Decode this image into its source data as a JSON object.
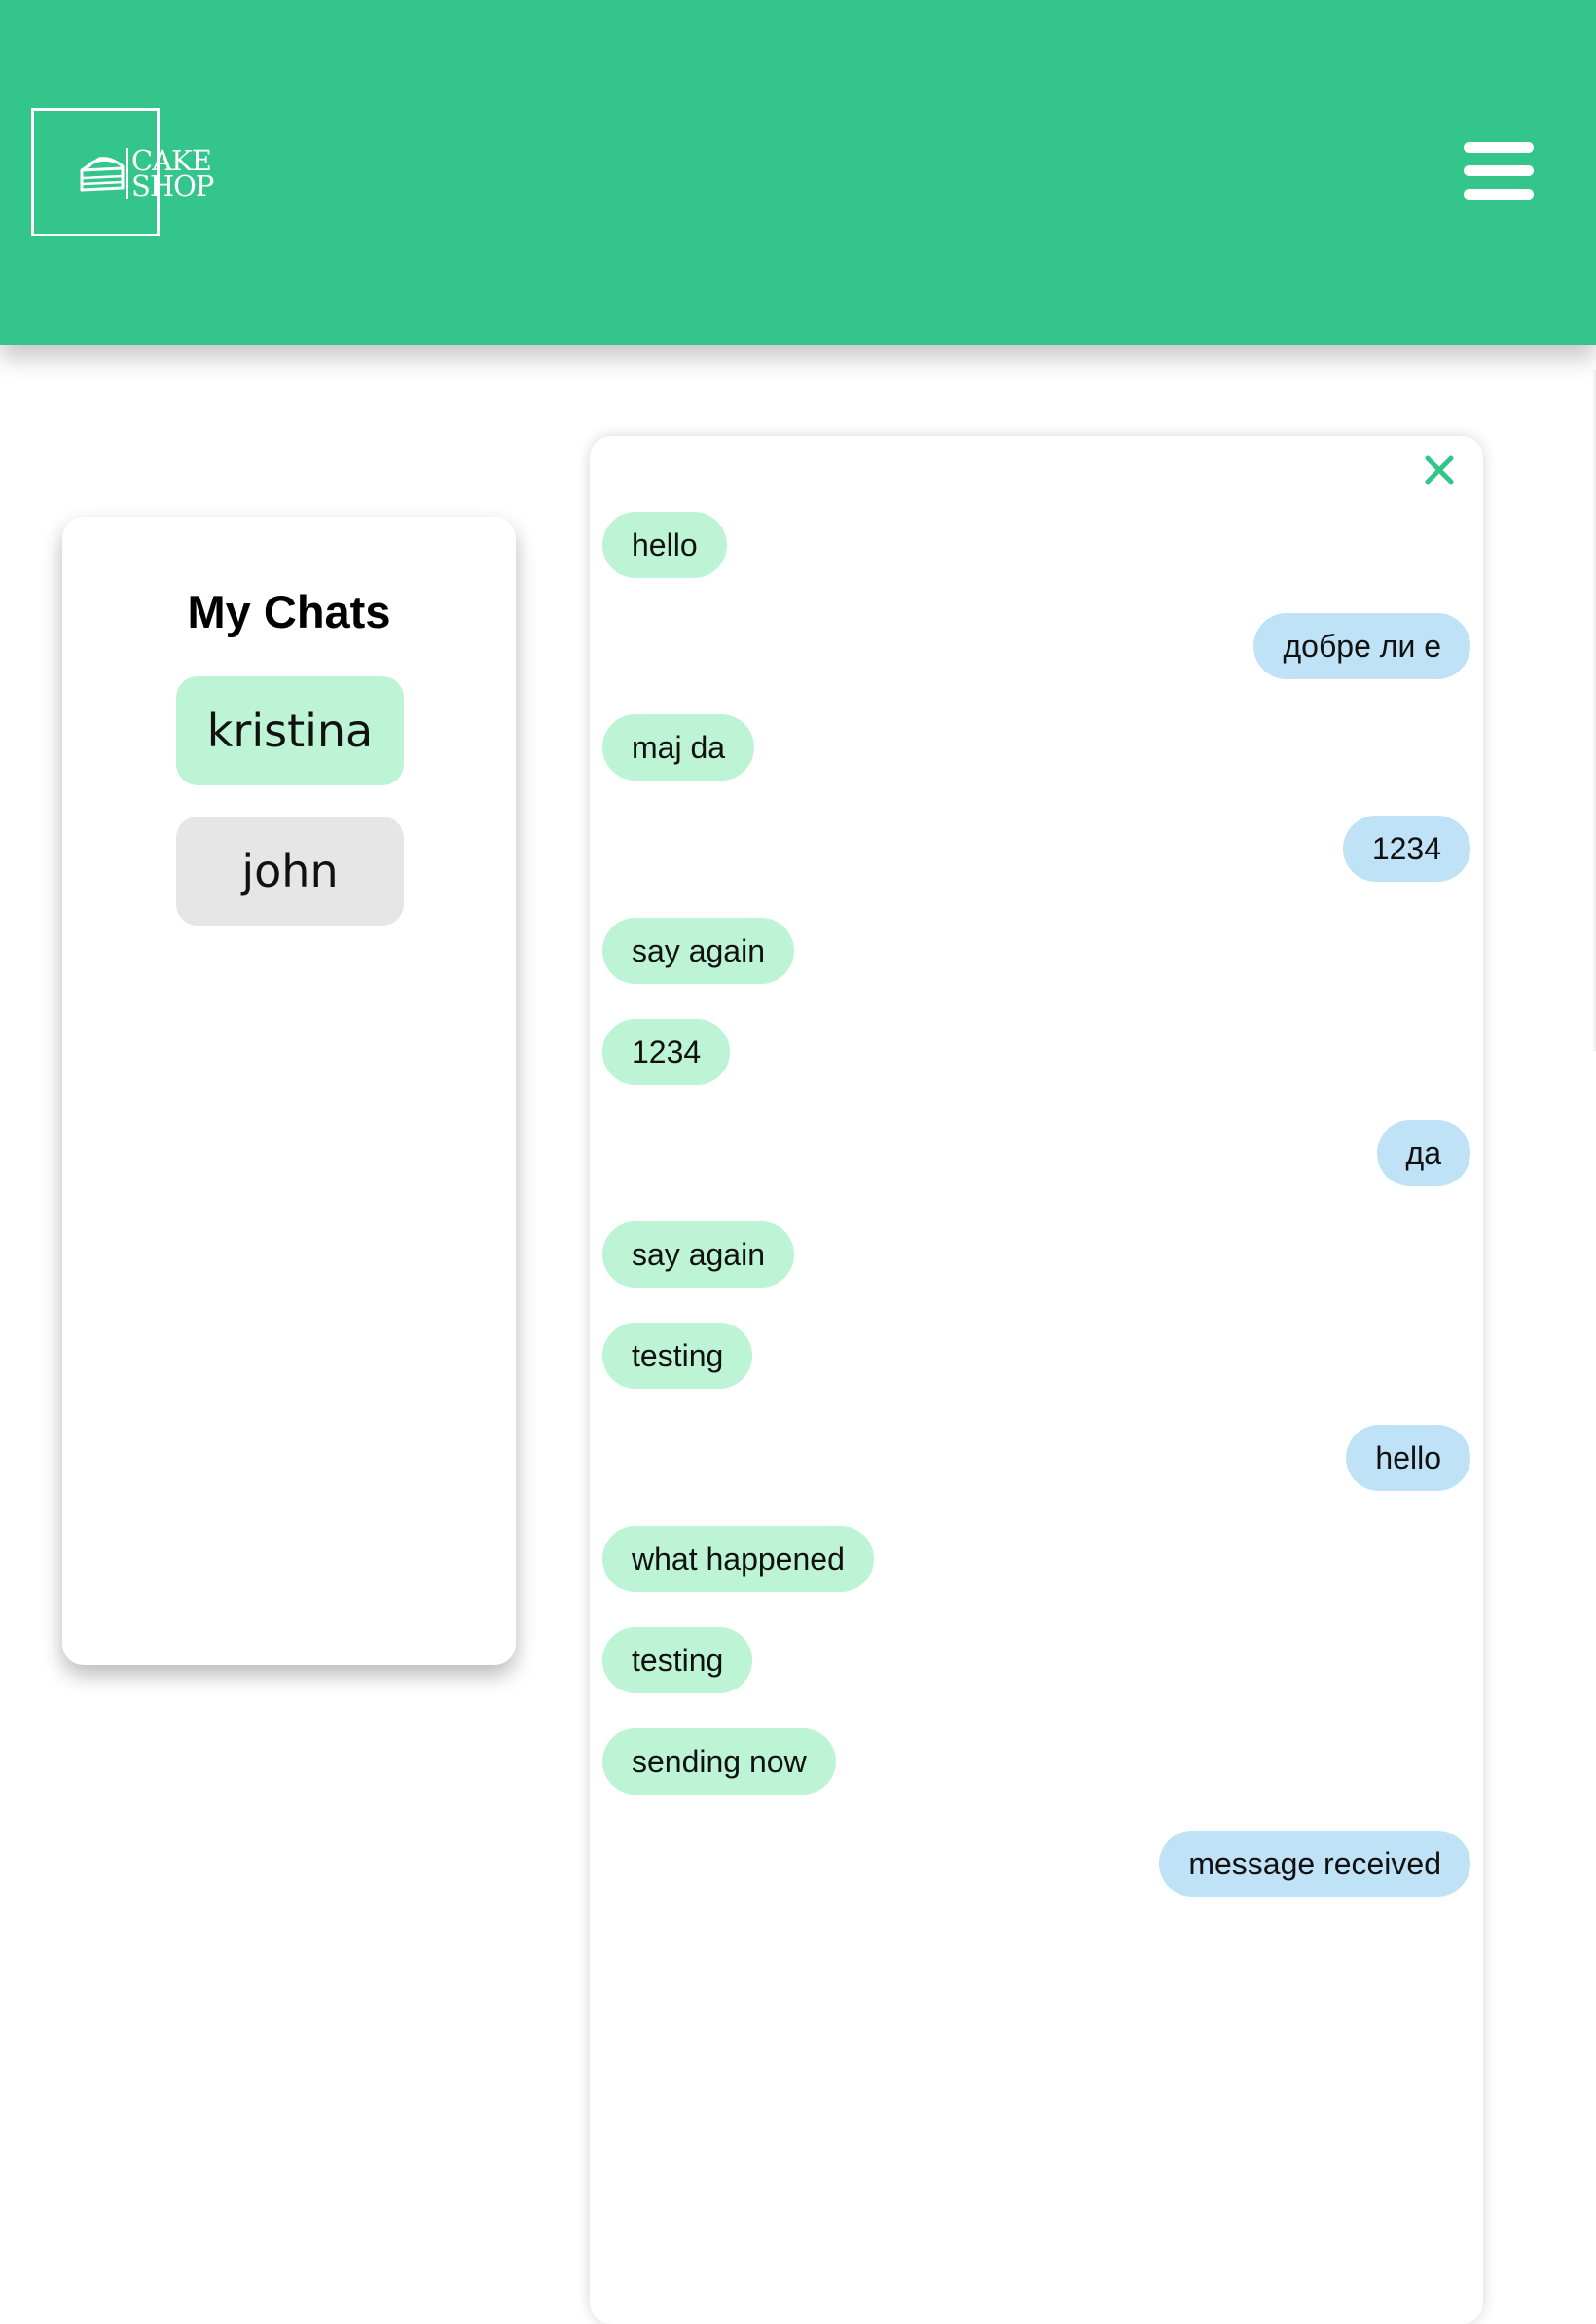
{
  "header": {
    "logo_line1": "CAKE",
    "logo_line2": "SHOP",
    "logo_icon": "cake-slice-icon",
    "menu_icon": "hamburger-menu-icon",
    "background_color": "#34c58c"
  },
  "sidebar": {
    "title": "My Chats",
    "chats": [
      {
        "name": "kristina",
        "active": true,
        "color": "#bdf4d6"
      },
      {
        "name": "john",
        "active": false,
        "color": "#e6e6e6"
      }
    ]
  },
  "conversation": {
    "close_icon": "close-icon",
    "incoming_color": "#bdf4d6",
    "outgoing_color": "#bfe2f7",
    "messages": [
      {
        "text": "hello",
        "direction": "in"
      },
      {
        "text": "добре ли е",
        "direction": "out"
      },
      {
        "text": "maj da",
        "direction": "in"
      },
      {
        "text": "1234",
        "direction": "out"
      },
      {
        "text": "say again",
        "direction": "in"
      },
      {
        "text": "1234",
        "direction": "in"
      },
      {
        "text": "да",
        "direction": "out"
      },
      {
        "text": "say again",
        "direction": "in"
      },
      {
        "text": "testing",
        "direction": "in"
      },
      {
        "text": "hello",
        "direction": "out"
      },
      {
        "text": "what happened",
        "direction": "in"
      },
      {
        "text": "testing",
        "direction": "in"
      },
      {
        "text": "sending now",
        "direction": "in"
      },
      {
        "text": "message received",
        "direction": "out"
      }
    ]
  }
}
